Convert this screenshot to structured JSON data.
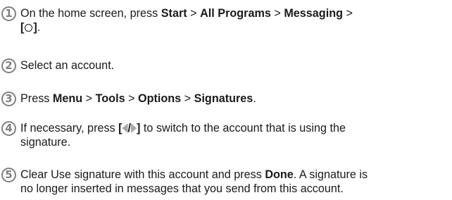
{
  "steps": [
    {
      "number": "1",
      "line1": {
        "t1": "On the home screen, press ",
        "b1": "Start",
        "t2": " > ",
        "b2": "All Programs",
        "t3": " > ",
        "b3": "Messaging",
        "t4": " >"
      },
      "line2": {
        "open": "[",
        "close": "]",
        "end": ".",
        "key_icon": "circle-key-icon"
      }
    },
    {
      "number": "2",
      "line1": "Select an account."
    },
    {
      "number": "3",
      "line1": {
        "t1": "Press ",
        "b1": "Menu",
        "t2": " > ",
        "b2": "Tools",
        "t3": " > ",
        "b3": "Options",
        "t4": " > ",
        "b4": "Signatures",
        "t5": "."
      }
    },
    {
      "number": "4",
      "line1": {
        "t1": "If necessary, press ",
        "open": "[",
        "slash": "/",
        "close": "]",
        "t2": " to switch to the account that is using the",
        "key_icons": [
          "left-key-icon",
          "right-key-icon"
        ]
      },
      "line2": "signature."
    },
    {
      "number": "5",
      "line1": {
        "t1": "Clear Use signature with this account and press ",
        "b1": "Done",
        "t2": ". A signature is"
      },
      "line2": "no longer inserted in messages that you send from this account."
    }
  ],
  "colors": {
    "step_number": "#808080",
    "text": "#1a1a1a",
    "key_icon_fill": "#a8a8a8"
  }
}
